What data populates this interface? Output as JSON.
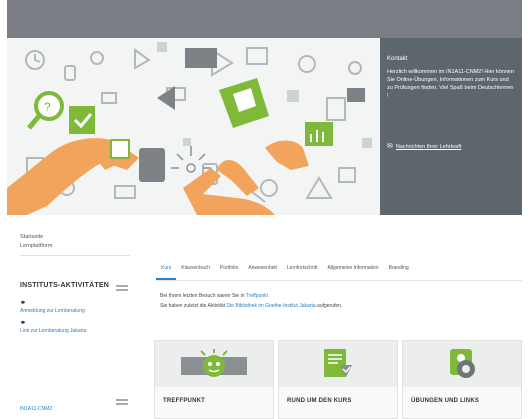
{
  "contact": {
    "title": "Kontakt",
    "text": "Herzlich willkommen im IN1A11-CNM2! Hier können Sie Online-Übungen, Informationen zum Kurs und zu Prüfungen finden. Viel Spaß beim Deutschlernen !",
    "message_link": "Nachrichten Ihrer Lehrkraft"
  },
  "nav": {
    "items": [
      "Startseite",
      "Lernplattform"
    ]
  },
  "institute_block": {
    "title": "INSTITUTS-AKTIVITÄTEN",
    "links": [
      "Anmeldung zur Lernberatung",
      "Link zur Lernberatung Jakarta"
    ]
  },
  "course_block": {
    "link": "IN1A11-CNM2"
  },
  "tabs": [
    "Kurs",
    "Klassenbuch",
    "Portfolio",
    "Anwesenheit",
    "Lernfortschritt",
    "Allgemeine Information",
    "Branding"
  ],
  "active_tab": "Kurs",
  "last_visit": {
    "line1_prefix": "Bei Ihrem letzten Besuch waren Sie in ",
    "line1_link": "Treffpunkt",
    "line2_prefix": "Sie haben zuletzt die Aktivität ",
    "line2_link": "Die Bibliothek im Goethe-Institut Jakarta",
    "line2_suffix": " aufgerufen."
  },
  "cards": [
    {
      "title": "TREFFPUNKT",
      "icon": "meeting-icon"
    },
    {
      "title": "RUND UM DEN KURS",
      "icon": "course-document-icon"
    },
    {
      "title": "ÜBUNGEN UND LINKS",
      "icon": "exercises-icon"
    }
  ],
  "colors": {
    "accent": "#2c80c4",
    "green": "#7fb93a",
    "contact_bg": "#5d666d",
    "topbar_bg": "#7a7e84"
  }
}
